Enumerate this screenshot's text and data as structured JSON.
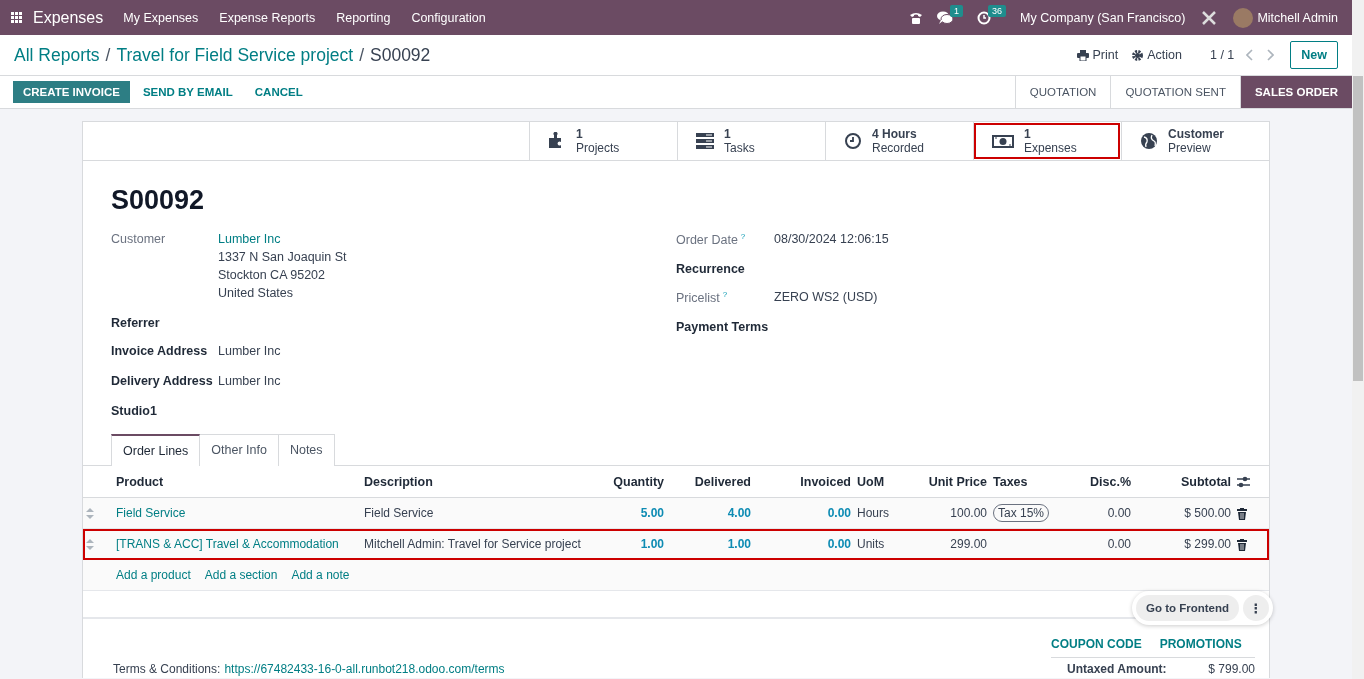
{
  "navbar": {
    "app_name": "Expenses",
    "menu": [
      "My Expenses",
      "Expense Reports",
      "Reporting",
      "Configuration"
    ],
    "chat_badge": "1",
    "activity_badge": "36",
    "company": "My Company (San Francisco)",
    "user": "Mitchell Admin"
  },
  "breadcrumbs": {
    "separator": "/",
    "parents": [
      "All Reports",
      "Travel for Field Service project"
    ],
    "current": "S00092"
  },
  "control": {
    "print": "Print",
    "action": "Action",
    "pager": "1 / 1",
    "new": "New"
  },
  "buttons": [
    {
      "label": "CREATE INVOICE",
      "primary": true
    },
    {
      "label": "SEND BY EMAIL",
      "primary": false
    },
    {
      "label": "CANCEL",
      "primary": false
    }
  ],
  "statusbar": [
    {
      "label": "QUOTATION",
      "selected": false
    },
    {
      "label": "QUOTATION SENT",
      "selected": false
    },
    {
      "label": "SALES ORDER",
      "selected": true
    }
  ],
  "smart_buttons": [
    {
      "kind": "projects",
      "value": "1",
      "label": "Projects",
      "highlighted": false
    },
    {
      "kind": "tasks",
      "value": "1",
      "label": "Tasks",
      "highlighted": false
    },
    {
      "kind": "hours",
      "value": "4 Hours",
      "label": "Recorded",
      "highlighted": false
    },
    {
      "kind": "expenses",
      "value": "1",
      "label": "Expenses",
      "highlighted": true
    },
    {
      "kind": "preview",
      "value": "Customer",
      "label": "Preview",
      "highlighted": false
    }
  ],
  "title": "S00092",
  "left_fields": [
    {
      "label": "Customer",
      "strong": false,
      "value": "Lumber Inc",
      "lines": [
        "1337 N San Joaquin St",
        "Stockton CA 95202",
        "United States"
      ]
    },
    {
      "label": "Referrer",
      "strong": true
    },
    {
      "label": "Invoice Address",
      "strong": true,
      "value": "Lumber Inc"
    },
    {
      "label": "Delivery Address",
      "strong": true,
      "value": "Lumber Inc"
    },
    {
      "label": "Studio1",
      "strong": true
    }
  ],
  "right_fields": [
    {
      "label": "Order Date",
      "help": "?",
      "strong": false,
      "value": "08/30/2024 12:06:15"
    },
    {
      "label": "Recurrence",
      "strong": true
    },
    {
      "label": "Pricelist",
      "help": "?",
      "strong": false,
      "value": "ZERO WS2 (USD)"
    },
    {
      "label": "Payment Terms",
      "strong": true
    }
  ],
  "tabs": [
    {
      "label": "Order Lines",
      "selected": true
    },
    {
      "label": "Other Info",
      "selected": false
    },
    {
      "label": "Notes",
      "selected": false
    }
  ],
  "table": {
    "columns": [
      "Product",
      "Description",
      "Quantity",
      "Delivered",
      "Invoiced",
      "UoM",
      "Unit Price",
      "Taxes",
      "Disc.%",
      "Subtotal"
    ],
    "rows": [
      {
        "highlighted": false,
        "cells": [
          "Field Service",
          "Field Service",
          "5.00",
          "4.00",
          "0.00",
          "Hours",
          "100.00",
          [
            "Tax 15%"
          ],
          "0.00",
          "$ 500.00"
        ]
      },
      {
        "highlighted": true,
        "cells": [
          "[TRANS & ACC] Travel & Accommodation",
          "Mitchell Admin: Travel for Service project",
          "1.00",
          "1.00",
          "0.00",
          "Units",
          "299.00",
          [],
          "0.00",
          "$ 299.00"
        ]
      }
    ],
    "add_links": [
      "Add a product",
      "Add a section",
      "Add a note"
    ]
  },
  "footer": {
    "links": [
      "COUPON CODE",
      "PROMOTIONS"
    ],
    "terms_label": "Terms & Conditions:",
    "terms_link": "https://67482433-16-0-all.runbot218.odoo.com/terms",
    "total_label": "Untaxed Amount:",
    "total_value": "$ 799.00"
  },
  "floating": {
    "label": "Go to Frontend",
    "menu": "⋮"
  }
}
